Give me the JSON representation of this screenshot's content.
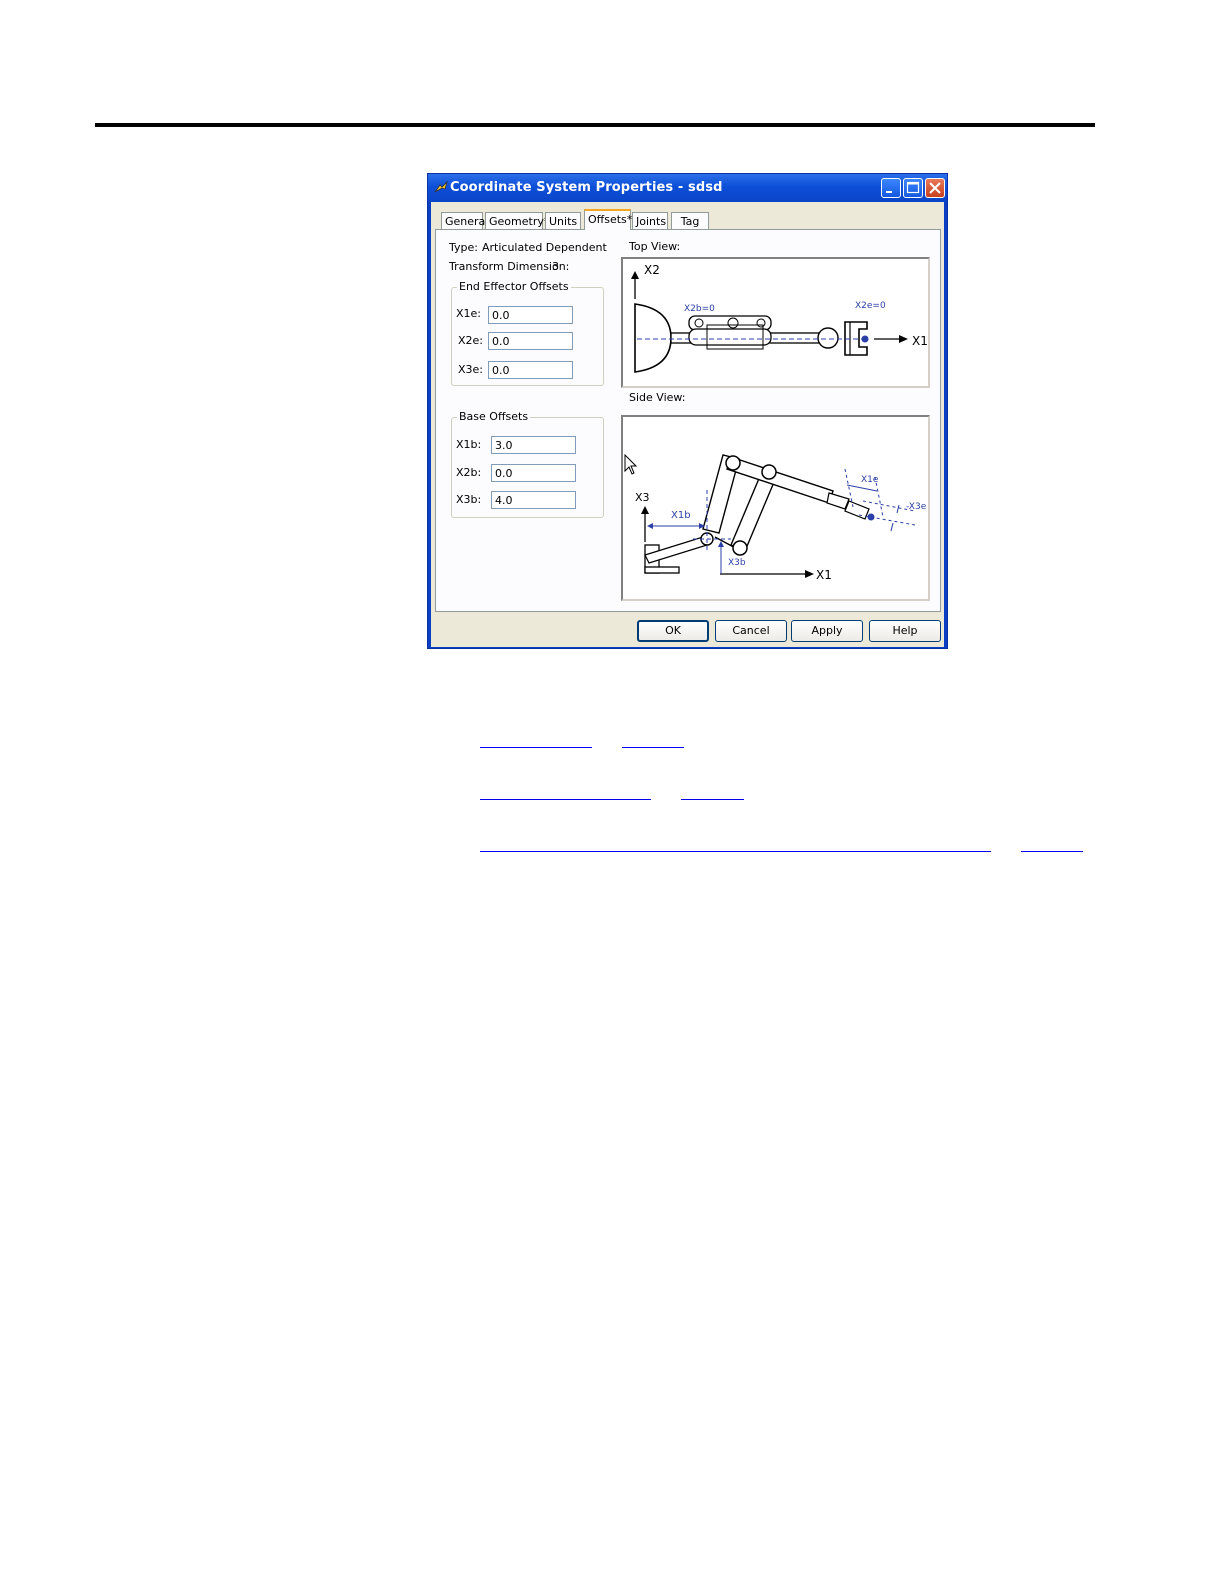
{
  "window": {
    "title": "Coordinate System Properties - sdsd"
  },
  "tabs": [
    "General",
    "Geometry*",
    "Units",
    "Offsets*",
    "Joints",
    "Tag"
  ],
  "selected_tab": "Offsets*",
  "info": {
    "type_label": "Type:",
    "type_value": "Articulated Dependent",
    "dimension_label": "Transform Dimension:",
    "dimension_value": "3"
  },
  "end_effector": {
    "legend": "End Effector Offsets",
    "x1_label": "X1e:",
    "x1_value": "0.0",
    "x2_label": "X2e:",
    "x2_value": "0.0",
    "x3_label": "X3e:",
    "x3_value": "0.0"
  },
  "base": {
    "legend": "Base Offsets",
    "x1_label": "X1b:",
    "x1_value": "3.0",
    "x2_label": "X2b:",
    "x2_value": "0.0",
    "x3_label": "X3b:",
    "x3_value": "4.0"
  },
  "top_view": {
    "caption": "Top View:",
    "x2": "X2",
    "x1": "X1",
    "x2b": "X2b=0",
    "x2e": "X2e=0"
  },
  "side_view": {
    "caption": "Side View:",
    "x3": "X3",
    "x1": "X1",
    "x1b": "X1b",
    "x3b": "X3b",
    "x1e": "X1e",
    "x3e": "-X3e"
  },
  "buttons": {
    "ok": "OK",
    "cancel": "Cancel",
    "apply": "Apply",
    "help": "Help"
  },
  "colors": {
    "annotation": "#2b3fa8",
    "title_bar": "#0d4fd8",
    "link": "#0000ee"
  }
}
